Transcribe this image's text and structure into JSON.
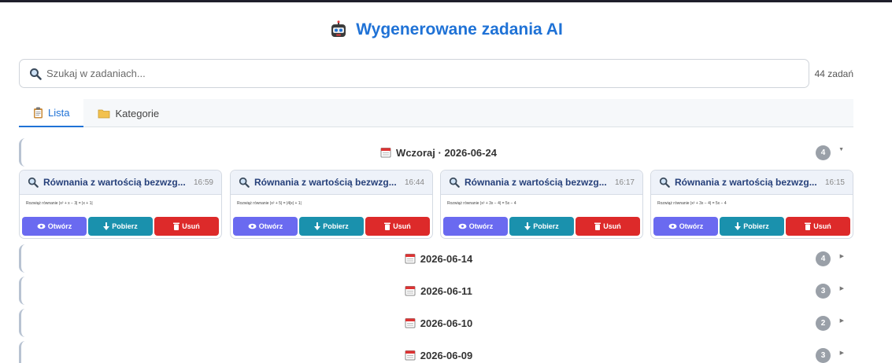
{
  "header": {
    "title": "Wygenerowane zadania AI",
    "icon": "robot-icon"
  },
  "search": {
    "placeholder": "Szukaj w zadaniach...",
    "value": "",
    "count_label": "44 zadań"
  },
  "tabs": [
    {
      "label": "Lista",
      "icon": "clipboard-icon",
      "active": true
    },
    {
      "label": "Kategorie",
      "icon": "folder-icon",
      "active": false
    }
  ],
  "groups": [
    {
      "label": "Wczoraj · 2026-06-24",
      "count": "4",
      "expanded": true
    },
    {
      "label": "2026-06-14",
      "count": "4",
      "expanded": false
    },
    {
      "label": "2026-06-11",
      "count": "3",
      "expanded": false
    },
    {
      "label": "2026-06-10",
      "count": "2",
      "expanded": false
    },
    {
      "label": "2026-06-09",
      "count": "3",
      "expanded": false
    }
  ],
  "cards": [
    {
      "title": "Równania z wartością bezwzg...",
      "time": "16:59",
      "body": "Rozwiąż równanie |x² + x − 3| = |x + 1|"
    },
    {
      "title": "Równania z wartością bezwzg...",
      "time": "16:44",
      "body": "Rozwiąż równanie |x² + 5| = |4|x| + 1|"
    },
    {
      "title": "Równania z wartością bezwzg...",
      "time": "16:17",
      "body": "Rozwiąż równanie |x² + 3x − 4| = 5x − 4"
    },
    {
      "title": "Równania z wartością bezwzg...",
      "time": "16:15",
      "body": "Rozwiąż równanie |x² + 3x − 4| = 5x − 4"
    }
  ],
  "buttons": {
    "open": "Otwórz",
    "download": "Pobierz",
    "delete": "Usuń"
  },
  "colors": {
    "accent": "#1f72d6",
    "open": "#6a6af0",
    "download": "#1a91ad",
    "delete": "#dd2a2a",
    "badge": "#9aa0a8"
  }
}
